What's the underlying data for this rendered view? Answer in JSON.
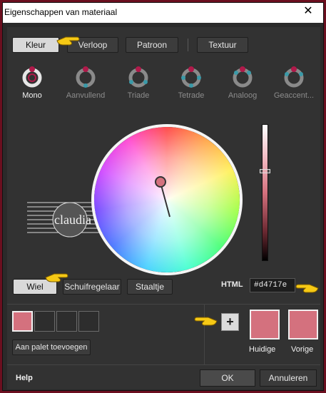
{
  "window": {
    "title": "Eigenschappen van materiaal",
    "close_glyph": "✕"
  },
  "tabs": [
    {
      "label": "Kleur",
      "active": true
    },
    {
      "label": "Verloop",
      "active": false
    },
    {
      "label": "Patroon",
      "active": false
    },
    {
      "label": "Textuur",
      "active": false
    }
  ],
  "schemes": [
    {
      "label": "Mono",
      "icon": "mono-scheme-icon",
      "active": true
    },
    {
      "label": "Aanvullend",
      "icon": "complementary-scheme-icon",
      "active": false
    },
    {
      "label": "Triade",
      "icon": "triad-scheme-icon",
      "active": false
    },
    {
      "label": "Tetrade",
      "icon": "tetrad-scheme-icon",
      "active": false
    },
    {
      "label": "Analoog",
      "icon": "analogous-scheme-icon",
      "active": false
    },
    {
      "label": "Geaccent...",
      "icon": "accented-scheme-icon",
      "active": false
    }
  ],
  "views": [
    {
      "label": "Wiel",
      "active": true
    },
    {
      "label": "Schuifregelaar",
      "active": false
    },
    {
      "label": "Staaltje",
      "active": false
    }
  ],
  "watermark": {
    "text": "claudia"
  },
  "html": {
    "label": "HTML",
    "value": "#d4717e"
  },
  "palette": {
    "add_label": "Aan palet toevoegen",
    "add_glyph": "+"
  },
  "current": {
    "label": "Huidige",
    "color": "#d4717e"
  },
  "previous": {
    "label": "Vorige",
    "color": "#d4717e"
  },
  "footer": {
    "help": "Help",
    "ok": "OK",
    "cancel": "Annuleren"
  },
  "colors": {
    "selected": "#d4717e",
    "accent_pointer": "#f6c915"
  }
}
